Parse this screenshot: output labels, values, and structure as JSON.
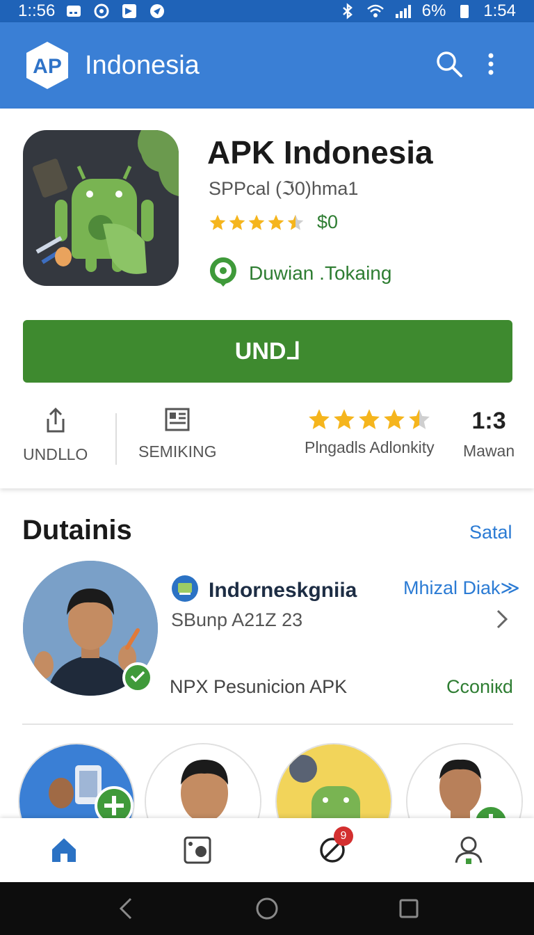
{
  "status_bar": {
    "time_left": "1::56",
    "battery": "6%",
    "time_right": "1:54"
  },
  "app_bar": {
    "logo_text": "AP",
    "title": "Indonesia"
  },
  "app": {
    "name": "APK Indonesia",
    "subtitle": "SPPcal (ℑ0)hma1",
    "rating": 4.5,
    "price": "$0",
    "developer": "Duwian .Tokaing",
    "install_label": "UNDᒧ"
  },
  "actions": {
    "share_label": "UNDᒪLO",
    "save_label": "SEMIKING",
    "rating_label": "Plngadls Adlonkity",
    "rating_stars": 4.5,
    "count_value": "1:3",
    "count_label": "Mawan"
  },
  "details": {
    "title": "Dutainis",
    "see_all": "Satal",
    "item": {
      "title": "Indorneskgniia",
      "link": "Mhizal Diak≫",
      "subtitle": "SBunp A21Z 23",
      "description": "NPX Pesunicion APK",
      "status": "Cconiкd"
    }
  },
  "bottom_nav": {
    "badge": "9"
  },
  "colors": {
    "primary": "#3a7fd5",
    "status": "#1f63b8",
    "accent_green": "#3e8a2f",
    "star": "#f5b51d"
  }
}
